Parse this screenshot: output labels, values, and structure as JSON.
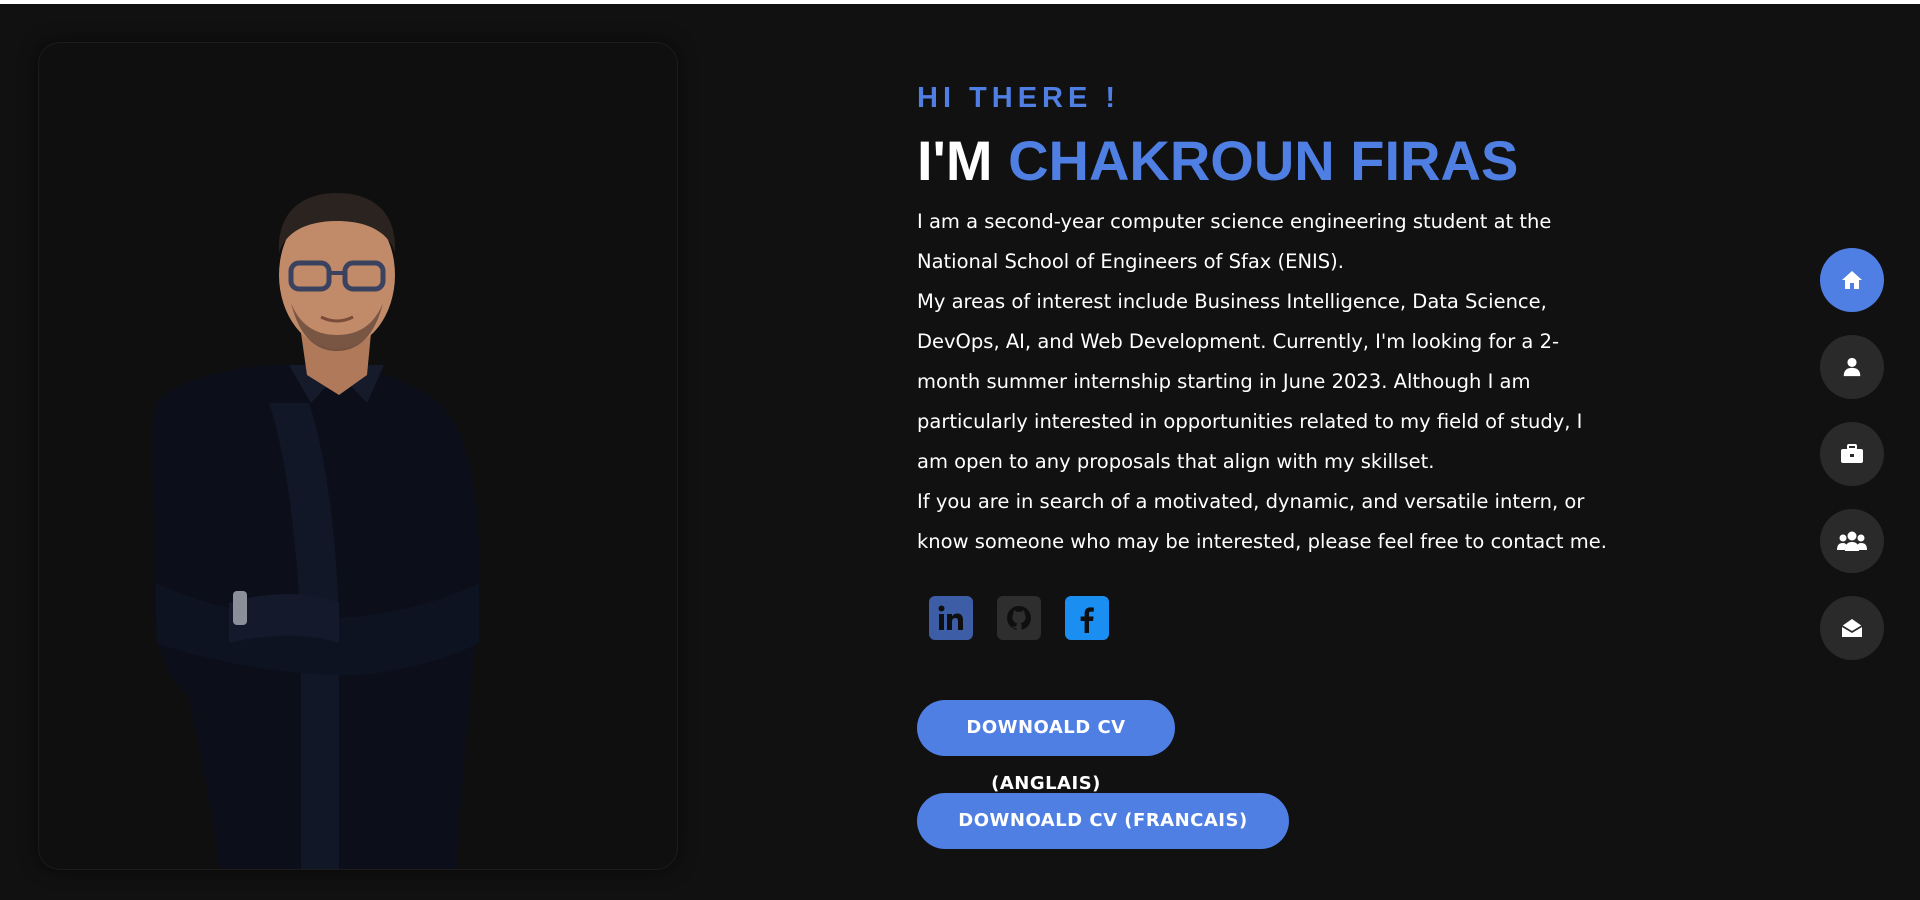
{
  "hero": {
    "greeting": "HI THERE !",
    "name_prefix": "I'M",
    "name_highlight": "CHAKROUN FIRAS",
    "bio": [
      "I am a second-year computer science engineering student at the National School of Engineers of Sfax (ENIS).",
      "My areas of interest include Business Intelligence, Data Science, DevOps, AI, and Web Development. Currently, I'm looking for a 2-month summer internship starting in June 2023. Although I am particularly interested in opportunities related to my field of study, I am open to any proposals that align with my skillset.",
      "If you are in search of a motivated, dynamic, and versatile intern, or know someone who may be interested, please feel free to contact me."
    ],
    "socials": [
      {
        "icon": "linkedin-icon"
      },
      {
        "icon": "github-icon"
      },
      {
        "icon": "facebook-icon"
      }
    ],
    "buttons": {
      "cv_english": "DOWNOALD CV (ANGLAIS)",
      "cv_french": "DOWNOALD CV (FRANCAIS)"
    }
  },
  "sidenav": [
    {
      "icon": "home-icon",
      "active": true
    },
    {
      "icon": "user-icon",
      "active": false
    },
    {
      "icon": "briefcase-icon",
      "active": false
    },
    {
      "icon": "users-icon",
      "active": false
    },
    {
      "icon": "envelope-open-icon",
      "active": false
    }
  ],
  "colors": {
    "accent": "#4f7fe3",
    "background": "#111111",
    "text": "#ffffff",
    "nav_inactive": "#2a2a2a"
  }
}
